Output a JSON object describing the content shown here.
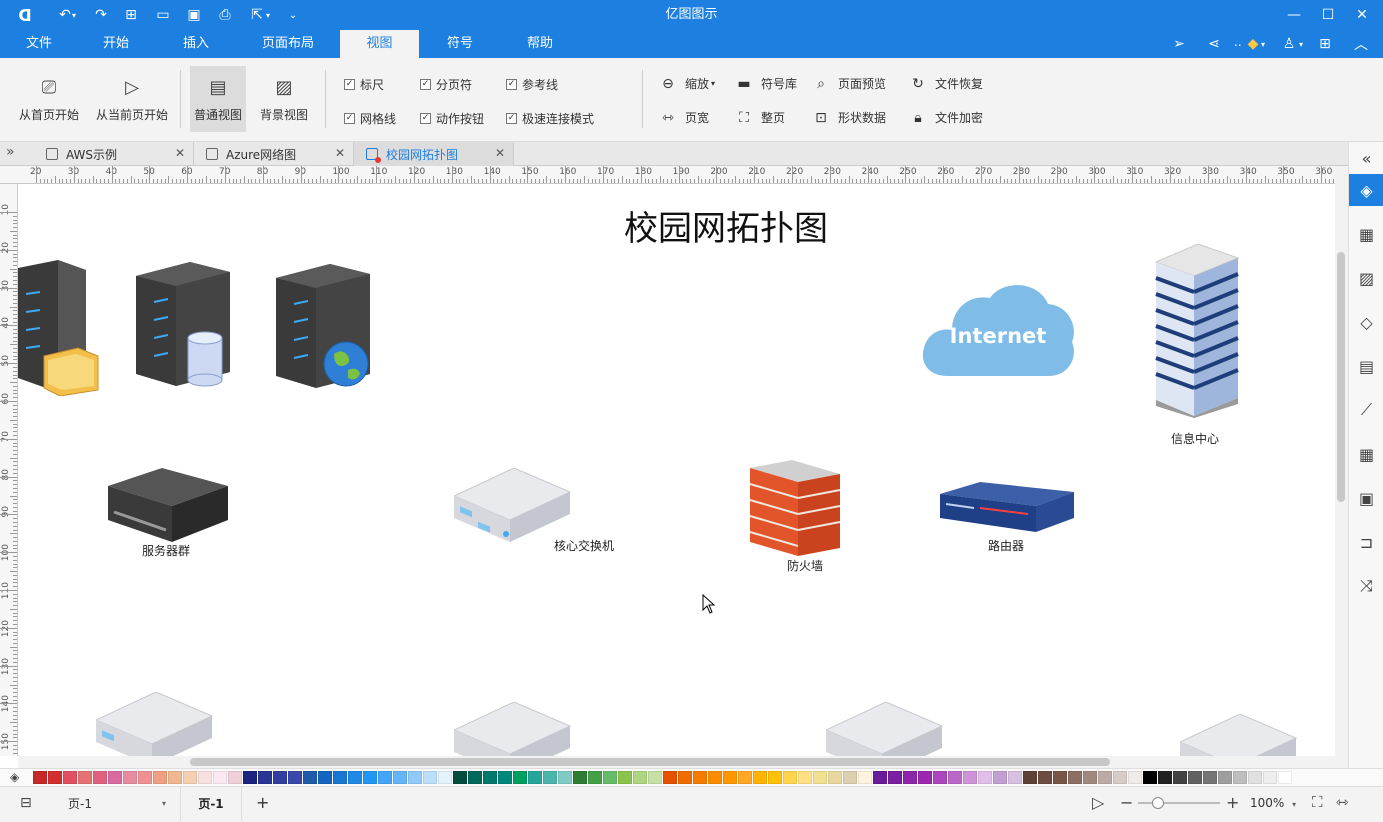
{
  "app": {
    "title": "亿图图示"
  },
  "menu": {
    "tabs": [
      {
        "label": "文件"
      },
      {
        "label": "开始"
      },
      {
        "label": "插入"
      },
      {
        "label": "页面布局"
      },
      {
        "label": "视图"
      },
      {
        "label": "符号"
      },
      {
        "label": "帮助"
      }
    ],
    "active_tab": "视图",
    "user_label": ".."
  },
  "ribbon": {
    "from_first": "从首页开始",
    "from_current": "从当前页开始",
    "normal_view": "普通视图",
    "background_view": "背景视图",
    "checks": {
      "ruler": {
        "label": "标尺",
        "checked": true
      },
      "page_break": {
        "label": "分页符",
        "checked": true
      },
      "guides": {
        "label": "参考线",
        "checked": true
      },
      "grid": {
        "label": "网格线",
        "checked": true
      },
      "action_button": {
        "label": "动作按钮",
        "checked": true
      },
      "quick_connect": {
        "label": "极速连接模式",
        "checked": true
      }
    },
    "zoom": "缩放",
    "symbol_lib": "符号库",
    "page_preview": "页面预览",
    "file_recover": "文件恢复",
    "page_width": "页宽",
    "whole_page": "整页",
    "shape_data": "形状数据",
    "file_encrypt": "文件加密"
  },
  "doc_tabs": [
    {
      "label": "AWS示例",
      "active": false
    },
    {
      "label": "Azure网络图",
      "active": false
    },
    {
      "label": "校园网拓扑图",
      "active": true
    }
  ],
  "ruler": {
    "top_labels": [
      "20",
      "30",
      "40",
      "50",
      "60",
      "70",
      "80",
      "90",
      "100",
      "110",
      "120",
      "130",
      "140",
      "150",
      "160",
      "170",
      "180",
      "190",
      "200",
      "210",
      "220",
      "230",
      "240",
      "250",
      "260",
      "270",
      "280",
      "290",
      "300",
      "310",
      "320",
      "330",
      "340",
      "350",
      "360"
    ],
    "left_labels": [
      "10",
      "20",
      "30",
      "40",
      "50",
      "60",
      "70",
      "80",
      "90",
      "100",
      "110",
      "120",
      "130",
      "140",
      "150"
    ]
  },
  "diagram": {
    "title": "校园网拓扑图",
    "cloud_text": "Internet",
    "labels": {
      "info_center": "信息中心",
      "server_group": "服务器群",
      "core_switch": "核心交换机",
      "firewall": "防火墙",
      "router": "路由器"
    }
  },
  "status": {
    "page_select": "页-1",
    "page_tab": "页-1",
    "zoom": "100%"
  },
  "palette": [
    "#c62828",
    "#d32f2f",
    "#e05060",
    "#e57373",
    "#e06080",
    "#d86aa0",
    "#e88aa0",
    "#f09090",
    "#f0a080",
    "#f0b890",
    "#f5d0b0",
    "#f8e0e0",
    "#fce8f0",
    "#f0d0d8",
    "#1a237e",
    "#283593",
    "#303f9f",
    "#3949ab",
    "#1e5aa8",
    "#1565c0",
    "#1976d2",
    "#1e88e5",
    "#2196f3",
    "#42a5f5",
    "#64b5f6",
    "#90caf9",
    "#bbdefb",
    "#e3f2fd",
    "#004d40",
    "#00695c",
    "#00796b",
    "#00897b",
    "#00a060",
    "#26a69a",
    "#4db6ac",
    "#80cbc4",
    "#2e7d32",
    "#43a047",
    "#66bb6a",
    "#8bc34a",
    "#aed581",
    "#c5e1a5",
    "#e65100",
    "#ef6c00",
    "#f57c00",
    "#fb8c00",
    "#ff9800",
    "#ffa726",
    "#ffb300",
    "#ffc107",
    "#ffd54f",
    "#ffe082",
    "#f0e090",
    "#e8d8a0",
    "#ddd0b0",
    "#fff3e0",
    "#6a1b9a",
    "#7b1fa2",
    "#8e24aa",
    "#9c27b0",
    "#ab47bc",
    "#ba68c8",
    "#ce93d8",
    "#e1bee7",
    "#c0a0d0",
    "#d8c0e0",
    "#5d4037",
    "#6d4c41",
    "#795548",
    "#8d6e63",
    "#a1887f",
    "#bcaaa4",
    "#d7ccc8",
    "#efebe9",
    "#000000",
    "#212121",
    "#424242",
    "#616161",
    "#757575",
    "#9e9e9e",
    "#bdbdbd",
    "#e0e0e0",
    "#eeeeee",
    "#ffffff"
  ]
}
